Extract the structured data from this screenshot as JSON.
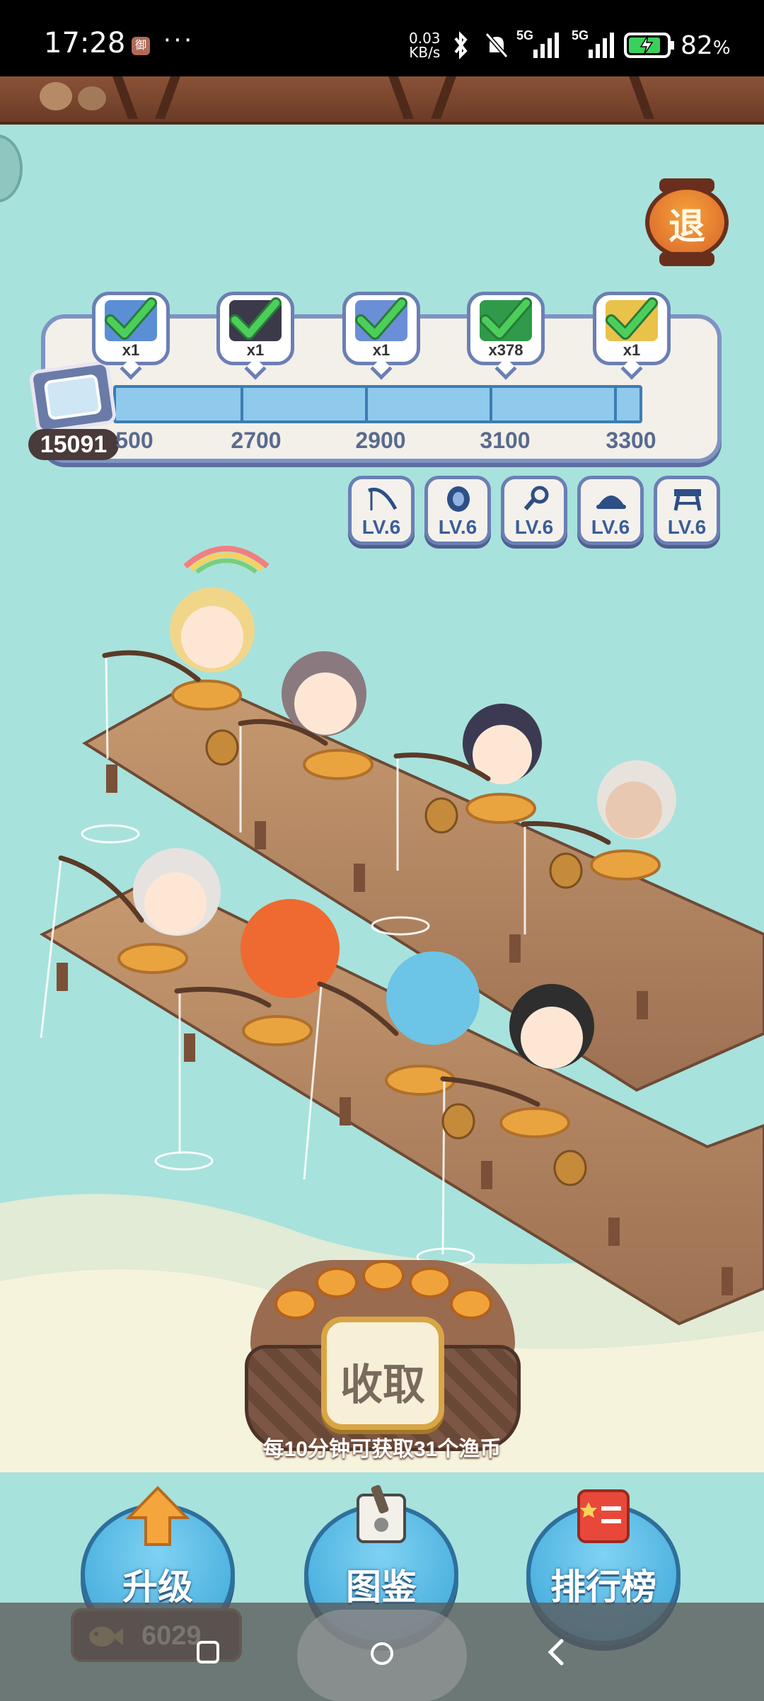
{
  "status_bar": {
    "time": "17:28",
    "app_badge": "御",
    "more": "···",
    "net_speed_value": "0.03",
    "net_speed_unit": "KB/s",
    "signal_1": "5G",
    "signal_2": "5G",
    "battery_percent": "82",
    "battery_unit": "%"
  },
  "game": {
    "exit_label": "退",
    "coin_count": "15091",
    "progress": {
      "milestones": [
        {
          "qty": "x1",
          "threshold": "2500",
          "threshold_visible": "500",
          "claimed": true,
          "reward_color": "#5a8fd6"
        },
        {
          "qty": "x1",
          "threshold": "2700",
          "claimed": true,
          "reward_color": "#3a3a4a"
        },
        {
          "qty": "x1",
          "threshold": "2900",
          "claimed": true,
          "reward_color": "#6a8fd6"
        },
        {
          "qty": "x378",
          "threshold": "3100",
          "claimed": true,
          "reward_color": "#2f9a4a"
        },
        {
          "qty": "x1",
          "threshold": "3300",
          "claimed": true,
          "reward_color": "#e9c24a"
        }
      ],
      "fill": 1.0
    },
    "gear_levels": [
      {
        "icon": "fishing-rod-icon",
        "level": "LV.6"
      },
      {
        "icon": "reel-icon",
        "level": "LV.6"
      },
      {
        "icon": "hook-icon",
        "level": "LV.6"
      },
      {
        "icon": "hat-icon",
        "level": "LV.6"
      },
      {
        "icon": "stool-icon",
        "level": "LV.6"
      }
    ],
    "collect": {
      "button_label": "收取",
      "hint": "每10分钟可获取31个渔币"
    },
    "bottom": {
      "upgrade_label": "升级",
      "catalog_label": "图鉴",
      "ranking_label": "排行榜",
      "fish_coins": "6029"
    }
  },
  "colors": {
    "water": "#a8e2dc",
    "panel_border": "#7f93c3",
    "button_blue": "#3aa5d8",
    "exit_orange": "#f7a33a"
  }
}
